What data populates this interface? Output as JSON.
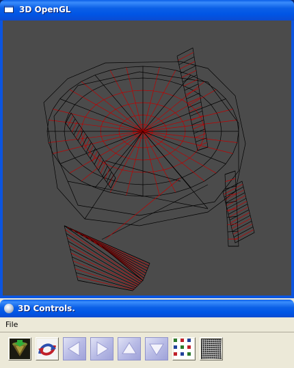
{
  "main_window": {
    "title": "3D OpenGL",
    "icon": "window-icon",
    "viewport_background": "#4b4b4b",
    "wireframe_colors": {
      "structure": "#000000",
      "detail": "#c00000"
    }
  },
  "controls_window": {
    "title": "3D Controls.",
    "icon": "sphere-icon",
    "menu": [
      {
        "label": "File"
      }
    ],
    "toolbar": [
      {
        "name": "render-mode-icon"
      },
      {
        "name": "rotate-mode-icon"
      },
      {
        "name": "arrow-left-icon"
      },
      {
        "name": "arrow-right-icon"
      },
      {
        "name": "arrow-up-icon"
      },
      {
        "name": "arrow-down-icon"
      },
      {
        "name": "texture-checker-icon"
      },
      {
        "name": "wireframe-grid-icon"
      }
    ]
  }
}
